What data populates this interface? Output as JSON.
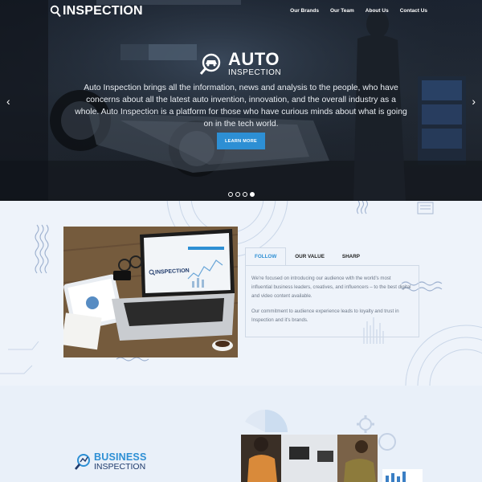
{
  "header": {
    "logo_text": "INSPECTION",
    "nav": [
      "Our Brands",
      "Our Team",
      "About Us",
      "Contact Us"
    ]
  },
  "hero": {
    "brand_big": "AUTO",
    "brand_small": "INSPECTION",
    "description": "Auto Inspection brings all the information, news and analysis to the people, who have concerns about all the latest auto invention, innovation, and the overall industry as a whole. Auto Inspection is a platform for those who have curious minds about what is going on in the tech world.",
    "button": "LEARN MORE",
    "prev_arrow": "‹",
    "next_arrow": "›",
    "slides": 4,
    "active_slide": 4
  },
  "about": {
    "tabs": [
      "FOLLOW",
      "OUR VALUE",
      "SHARP"
    ],
    "active_tab": "FOLLOW",
    "paragraph_1": "We're focused on introducing our audience with the world's most influential business leaders, creatives, and influencers – to the best digital and video content available.",
    "paragraph_2": "Our commitment to audience experience leads to loyalty and trust in Inspection and it's brands.",
    "laptop_screen_text": "INSPECTION"
  },
  "business": {
    "big": "BUSINESS",
    "small": "INSPECTION"
  },
  "colors": {
    "accent": "#2d8fd4",
    "hero_bg": "#1f2732",
    "page_bg": "#eef3fa",
    "navy": "#1f3a6b"
  }
}
